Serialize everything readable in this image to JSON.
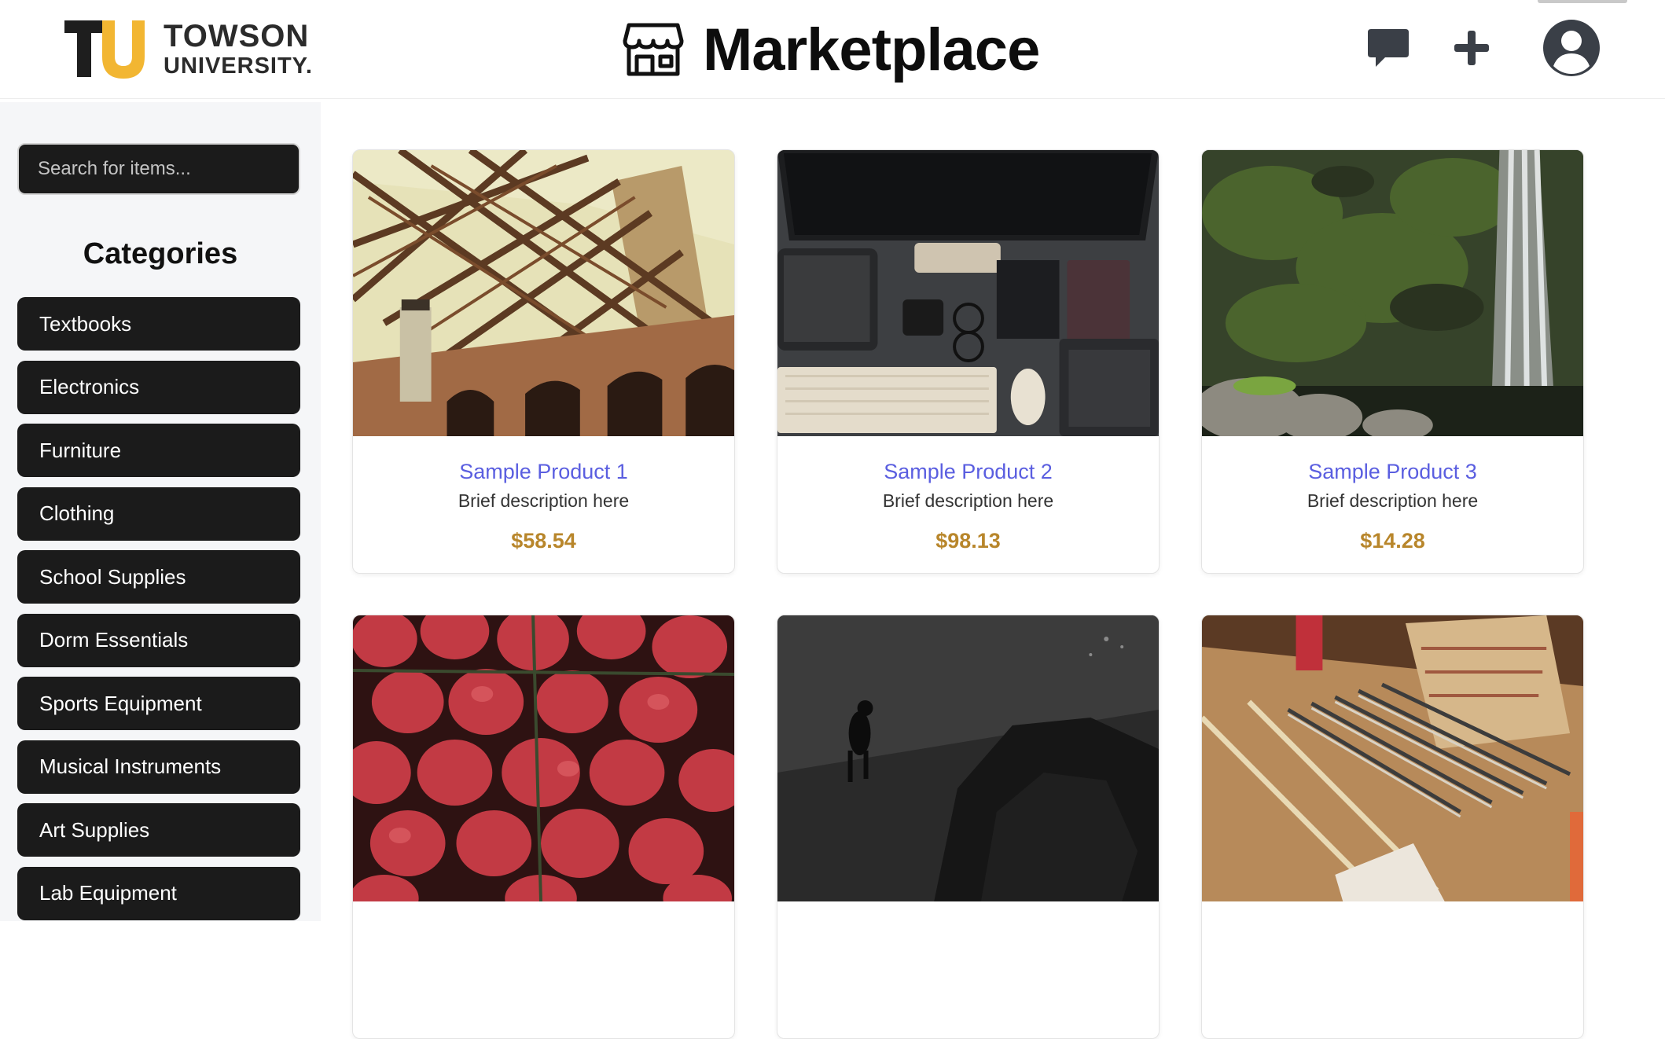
{
  "header": {
    "logo": {
      "line1": "TOWSON",
      "line2": "UNIVERSITY."
    },
    "title": "Marketplace",
    "icons": [
      "store-icon",
      "chat-icon",
      "plus-icon",
      "user-avatar-icon"
    ]
  },
  "sidebar": {
    "search_placeholder": "Search for items...",
    "categories_title": "Categories",
    "categories": [
      {
        "label": "Textbooks"
      },
      {
        "label": "Electronics"
      },
      {
        "label": "Furniture"
      },
      {
        "label": "Clothing"
      },
      {
        "label": "School Supplies"
      },
      {
        "label": "Dorm Essentials"
      },
      {
        "label": "Sports Equipment"
      },
      {
        "label": "Musical Instruments"
      },
      {
        "label": "Art Supplies"
      },
      {
        "label": "Lab Equipment"
      }
    ]
  },
  "products": [
    {
      "name": "Sample Product 1",
      "description": "Brief description here",
      "price": "$58.54"
    },
    {
      "name": "Sample Product 2",
      "description": "Brief description here",
      "price": "$98.13"
    },
    {
      "name": "Sample Product 3",
      "description": "Brief description here",
      "price": "$14.28"
    },
    {
      "name": "",
      "description": "",
      "price": ""
    },
    {
      "name": "",
      "description": "",
      "price": ""
    },
    {
      "name": "",
      "description": "",
      "price": ""
    }
  ],
  "colors": {
    "accent_link": "#5a5ee0",
    "price": "#b8862b",
    "button_bg": "#1b1b1b",
    "brand_gold": "#f2b632"
  }
}
